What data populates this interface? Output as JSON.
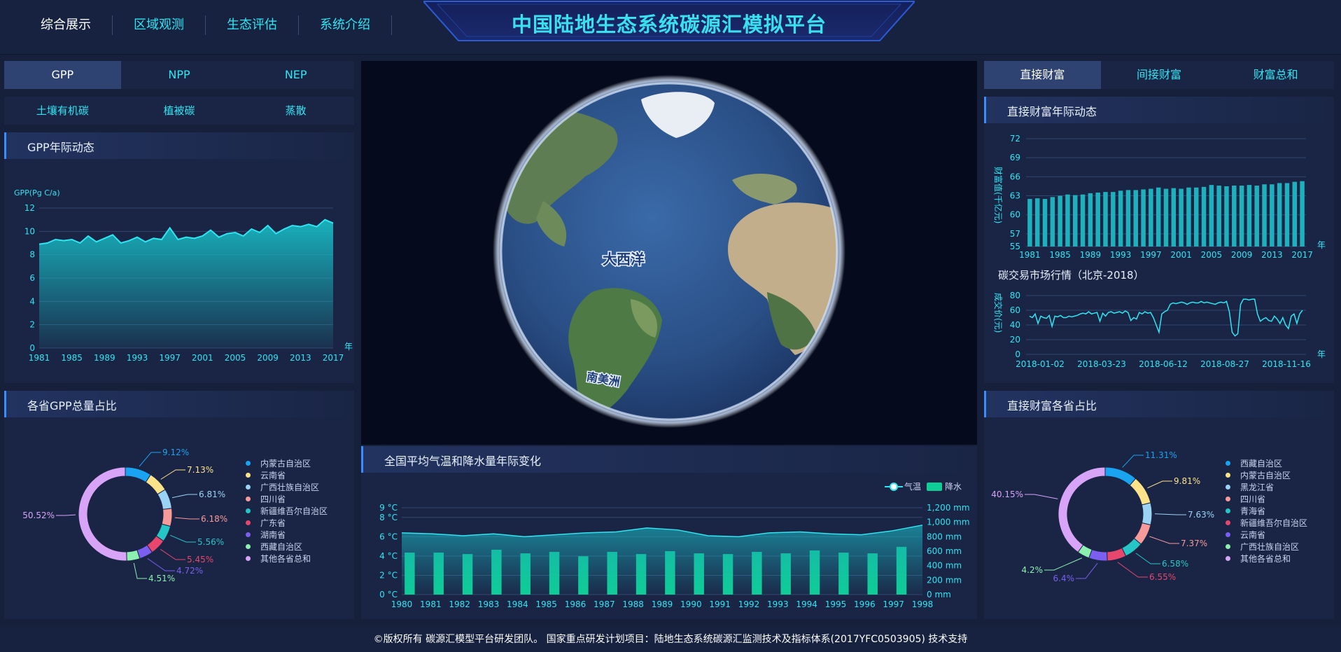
{
  "nav": {
    "items": [
      "综合展示",
      "区域观测",
      "生态评估",
      "系统介绍"
    ]
  },
  "header": {
    "title": "中国陆地生态系统碳源汇模拟平台"
  },
  "left": {
    "tabs": [
      "GPP",
      "NPP",
      "NEP"
    ],
    "subtabs": [
      "土壤有机碳",
      "植被碳",
      "蒸散"
    ],
    "gpp_title": "GPP年际动态",
    "pie_title": "各省GPP总量占比"
  },
  "right": {
    "tabs": [
      "直接财富",
      "间接财富",
      "财富总和"
    ],
    "wealth_title": "直接财富年际动态",
    "market_title": "碳交易市场行情（北京-2018）",
    "pie_title": "直接财富各省占比"
  },
  "globe": {
    "labels": [
      "大西洋",
      "南美洲"
    ]
  },
  "climate": {
    "title": "全国平均气温和降水量年际变化",
    "legend": [
      "气温",
      "降水"
    ]
  },
  "footer": {
    "text": "©版权所有 碳源汇模型平台研发团队。 国家重点研发计划项目：陆地生态系统碳源汇监测技术及指标体系(2017YFC0503905) 技术支持"
  },
  "colors": {
    "accent": "#2ee6f2",
    "panel": "#1a2545",
    "bg": "#16203b"
  },
  "chart_data": [
    {
      "type": "area",
      "id": "gpp",
      "ylabel": "GPP(Pg C/a)",
      "xunit": "年",
      "ylim": [
        0,
        12
      ],
      "yticks": [
        0,
        2,
        4,
        6,
        8,
        10,
        12
      ],
      "xticks": [
        "1981",
        "1985",
        "1989",
        "1993",
        "1997",
        "2001",
        "2005",
        "2009",
        "2013",
        "2017"
      ],
      "x": [
        1981,
        1982,
        1983,
        1984,
        1985,
        1986,
        1987,
        1988,
        1989,
        1990,
        1991,
        1992,
        1993,
        1994,
        1995,
        1996,
        1997,
        1998,
        1999,
        2000,
        2001,
        2002,
        2003,
        2004,
        2005,
        2006,
        2007,
        2008,
        2009,
        2010,
        2011,
        2012,
        2013,
        2014,
        2015,
        2016,
        2017
      ],
      "values": [
        8.9,
        9.0,
        9.3,
        9.2,
        9.3,
        9.0,
        9.6,
        9.1,
        9.4,
        9.7,
        9.0,
        9.2,
        9.5,
        9.1,
        9.4,
        9.3,
        10.3,
        9.3,
        9.5,
        9.4,
        9.6,
        10.1,
        9.5,
        9.8,
        9.9,
        9.6,
        10.2,
        9.9,
        10.5,
        9.8,
        10.2,
        10.5,
        10.4,
        10.6,
        10.4,
        11.0,
        10.7
      ]
    },
    {
      "type": "bar",
      "id": "wealth",
      "ylabel": "财富值(千亿元)",
      "xunit": "年",
      "ylim": [
        55,
        72
      ],
      "yticks": [
        55,
        57,
        60,
        63,
        66,
        69,
        72
      ],
      "xticks": [
        "1981",
        "1985",
        "1989",
        "1993",
        "1997",
        "2001",
        "2005",
        "2009",
        "2013",
        "2017"
      ],
      "x": [
        1981,
        1982,
        1983,
        1984,
        1985,
        1986,
        1987,
        1988,
        1989,
        1990,
        1991,
        1992,
        1993,
        1994,
        1995,
        1996,
        1997,
        1998,
        1999,
        2000,
        2001,
        2002,
        2003,
        2004,
        2005,
        2006,
        2007,
        2008,
        2009,
        2010,
        2011,
        2012,
        2013,
        2014,
        2015,
        2016,
        2017
      ],
      "values": [
        62.5,
        62.6,
        62.5,
        62.8,
        63.0,
        63.2,
        63.1,
        63.2,
        63.4,
        63.5,
        63.6,
        63.6,
        63.8,
        63.9,
        63.9,
        64.0,
        64.1,
        64.3,
        64.1,
        64.2,
        64.1,
        64.3,
        64.3,
        64.4,
        64.7,
        64.6,
        64.5,
        64.6,
        64.6,
        64.7,
        64.6,
        64.8,
        64.8,
        65.0,
        65.0,
        65.2,
        65.3
      ]
    },
    {
      "type": "line",
      "id": "market",
      "ylabel": "成交价(元)",
      "xunit": "年",
      "ylim": [
        0,
        80
      ],
      "yticks": [
        0,
        20,
        40,
        60,
        80
      ],
      "xticks": [
        "2018-01-02",
        "2018-03-23",
        "2018-06-12",
        "2018-08-27",
        "2018-11-16"
      ],
      "values": [
        52,
        50,
        55,
        42,
        52,
        50,
        49,
        53,
        38,
        52,
        51,
        53,
        50,
        50,
        52,
        51,
        52,
        53,
        55,
        56,
        55,
        58,
        55,
        56,
        57,
        45,
        56,
        52,
        57,
        58,
        56,
        57,
        58,
        56,
        59,
        57,
        46,
        50,
        48,
        57,
        55,
        58,
        56,
        57,
        50,
        40,
        30,
        55,
        58,
        60,
        68,
        70,
        69,
        70,
        71,
        70,
        68,
        70,
        71,
        70,
        70,
        72,
        70,
        71,
        70,
        69,
        68,
        70,
        71,
        70,
        72,
        58,
        30,
        25,
        28,
        68,
        75,
        75,
        74,
        75,
        75,
        55,
        45,
        48,
        50,
        46,
        45,
        52,
        48,
        42,
        50,
        40,
        35,
        52,
        55,
        42,
        55,
        60
      ]
    },
    {
      "type": "bar",
      "id": "climate",
      "series": [
        {
          "name": "气温",
          "type": "line",
          "values": [
            6.4,
            6.3,
            6.1,
            6.3,
            6.0,
            6.2,
            6.4,
            6.5,
            6.9,
            6.7,
            6.1,
            6.0,
            6.4,
            6.5,
            6.3,
            6.2,
            6.6,
            7.2
          ]
        },
        {
          "name": "降水",
          "type": "bar",
          "values": [
            580,
            580,
            560,
            620,
            570,
            590,
            530,
            590,
            560,
            600,
            570,
            560,
            590,
            570,
            610,
            580,
            570,
            660
          ]
        }
      ],
      "categories": [
        "1980",
        "1981",
        "1982",
        "1983",
        "1984",
        "1985",
        "1986",
        "1987",
        "1988",
        "1989",
        "1990",
        "1991",
        "1992",
        "1993",
        "1994",
        "1995",
        "1996",
        "1997",
        "1998"
      ],
      "yticks_left": [
        "0 °C",
        "2 °C",
        "4 °C",
        "6 °C",
        "8 °C",
        "9 °C"
      ],
      "yticks_right": [
        "0 mm",
        "200 mm",
        "400 mm",
        "600 mm",
        "800 mm",
        "1,000 mm",
        "1,200 mm"
      ]
    },
    {
      "type": "pie",
      "id": "gpp_pie",
      "labels": [
        "内蒙古自治区",
        "云南省",
        "广西壮族自治区",
        "四川省",
        "新疆维吾尔自治区",
        "广东省",
        "湖南省",
        "西藏自治区",
        "其他各省总和"
      ],
      "values": [
        9.12,
        7.13,
        6.81,
        6.18,
        5.56,
        5.45,
        4.72,
        4.51,
        50.52
      ],
      "value_labels": [
        "9.12%",
        "7.13%",
        "6.81%",
        "6.18%",
        "5.56%",
        "5.45%",
        "4.72%",
        "4.51%",
        "50.52%"
      ],
      "colors": [
        "#1aa3f0",
        "#fce38a",
        "#9bd3f5",
        "#f99a9a",
        "#26c6c6",
        "#e8476d",
        "#7b5ff0",
        "#8cf0b0",
        "#d7a4f7"
      ]
    },
    {
      "type": "pie",
      "id": "wealth_pie",
      "labels": [
        "西藏自治区",
        "内蒙古自治区",
        "黑龙江省",
        "四川省",
        "青海省",
        "新疆维吾尔自治区",
        "云南省",
        "广西壮族自治区",
        "其他各省总和"
      ],
      "values": [
        11.31,
        9.81,
        7.63,
        7.37,
        6.58,
        6.55,
        6.4,
        4.2,
        40.15
      ],
      "value_labels": [
        "11.31%",
        "9.81%",
        "7.63%",
        "7.37%",
        "6.58%",
        "6.55%",
        "6.4%",
        "4.2%",
        "40.15%"
      ],
      "colors": [
        "#1aa3f0",
        "#fce38a",
        "#9bd3f5",
        "#f99a9a",
        "#26c6c6",
        "#e8476d",
        "#7b5ff0",
        "#8cf0b0",
        "#d7a4f7"
      ]
    }
  ]
}
